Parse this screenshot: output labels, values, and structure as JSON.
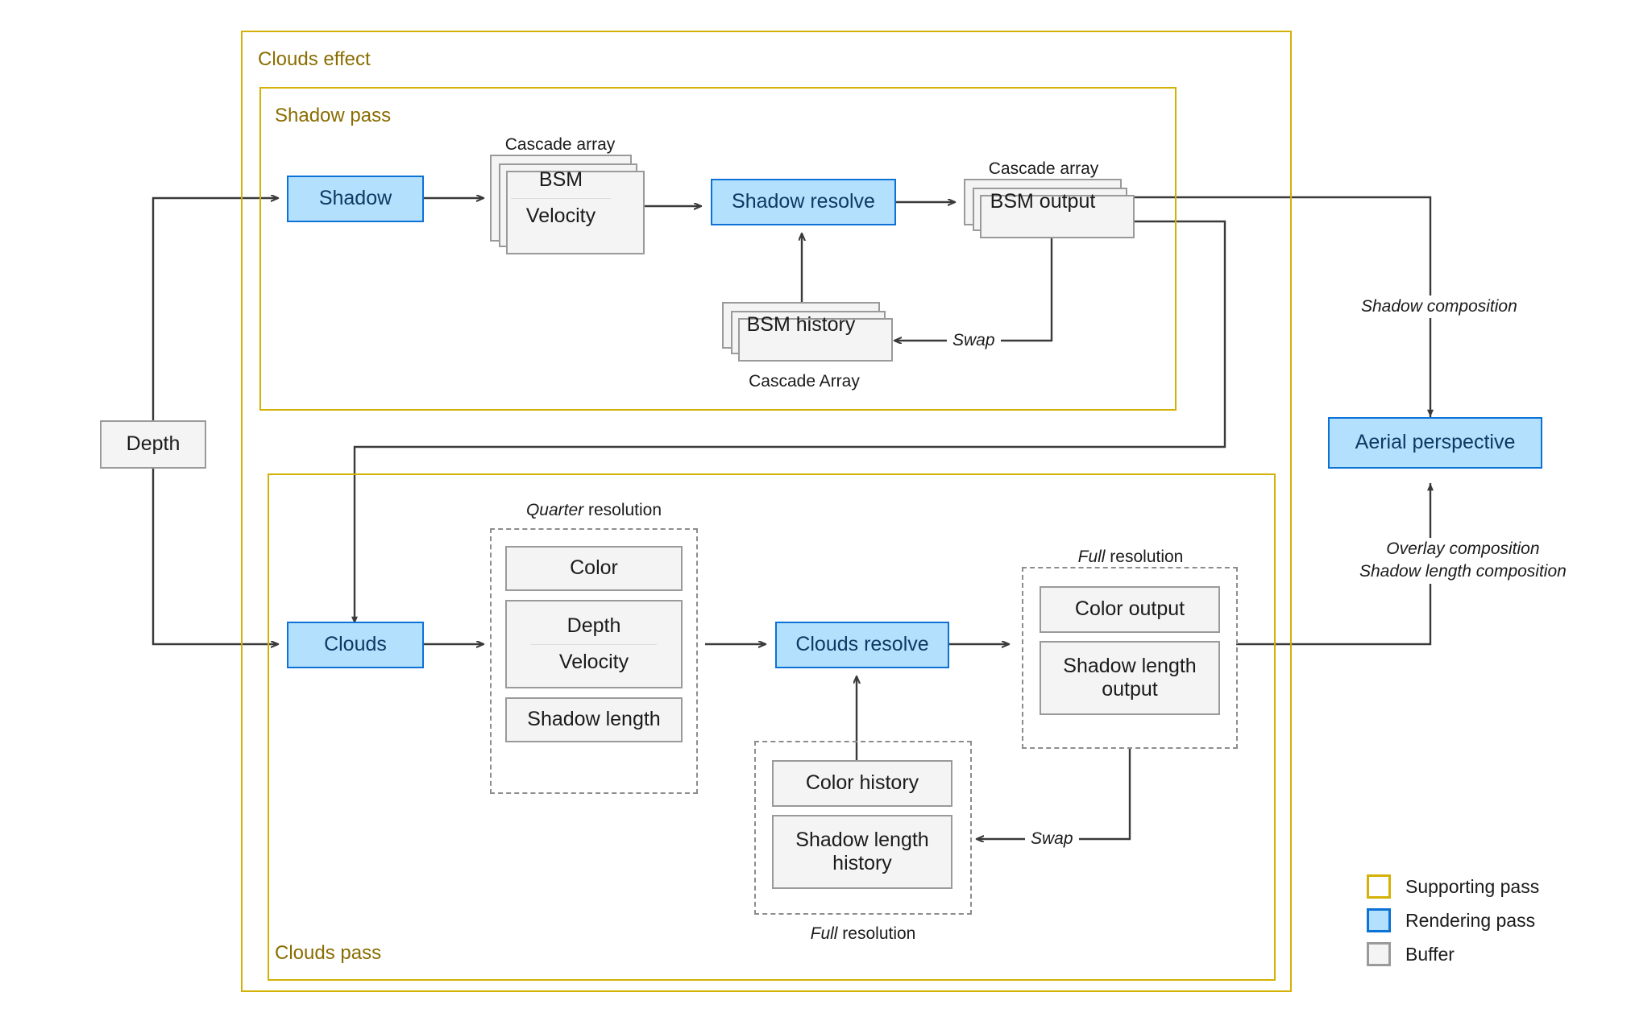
{
  "diagram": {
    "title_groups": {
      "clouds_effect": "Clouds effect",
      "shadow_pass": "Shadow pass",
      "clouds_pass": "Clouds pass"
    },
    "nodes": {
      "depth": "Depth",
      "shadow": "Shadow",
      "bsm": "BSM",
      "velocity_shadow": "Velocity",
      "shadow_resolve": "Shadow resolve",
      "bsm_output": "BSM output",
      "bsm_history": "BSM history",
      "clouds": "Clouds",
      "color": "Color",
      "depth_q": "Depth",
      "velocity_q": "Velocity",
      "shadow_length": "Shadow length",
      "clouds_resolve": "Clouds resolve",
      "color_output": "Color output",
      "shadow_length_output": "Shadow length output",
      "color_history": "Color history",
      "shadow_length_history": "Shadow length history",
      "aerial_perspective": "Aerial perspective"
    },
    "captions": {
      "cascade_array_bsm": "Cascade array",
      "cascade_array_bsm_output": "Cascade array",
      "cascade_array_history": "Cascade Array",
      "quarter_resolution_em": "Quarter",
      "quarter_resolution_rest": " resolution",
      "full_resolution_out_em": "Full",
      "full_resolution_out_rest": " resolution",
      "full_resolution_hist_em": "Full",
      "full_resolution_hist_rest": " resolution"
    },
    "edge_labels": {
      "swap_shadow": "Swap",
      "swap_clouds": "Swap",
      "shadow_composition": "Shadow composition",
      "overlay_composition_line1": "Overlay composition",
      "overlay_composition_line2": "Shadow length composition"
    },
    "legend": {
      "items": [
        {
          "label": "Supporting pass",
          "swatch": "supporting-pass-swatch"
        },
        {
          "label": "Rendering pass",
          "swatch": "rendering-pass-swatch"
        },
        {
          "label": "Buffer",
          "swatch": "buffer-swatch"
        }
      ]
    },
    "colors": {
      "supporting_pass_border": "#d4b106",
      "rendering_pass_fill": "#b3e0fd",
      "rendering_pass_border": "#0c72d6",
      "rendering_pass_text": "#0b3a63",
      "buffer_fill": "#f4f4f4",
      "buffer_border": "#9a9a9a",
      "wire": "#3a3a3a",
      "background": "#ffffff"
    }
  }
}
